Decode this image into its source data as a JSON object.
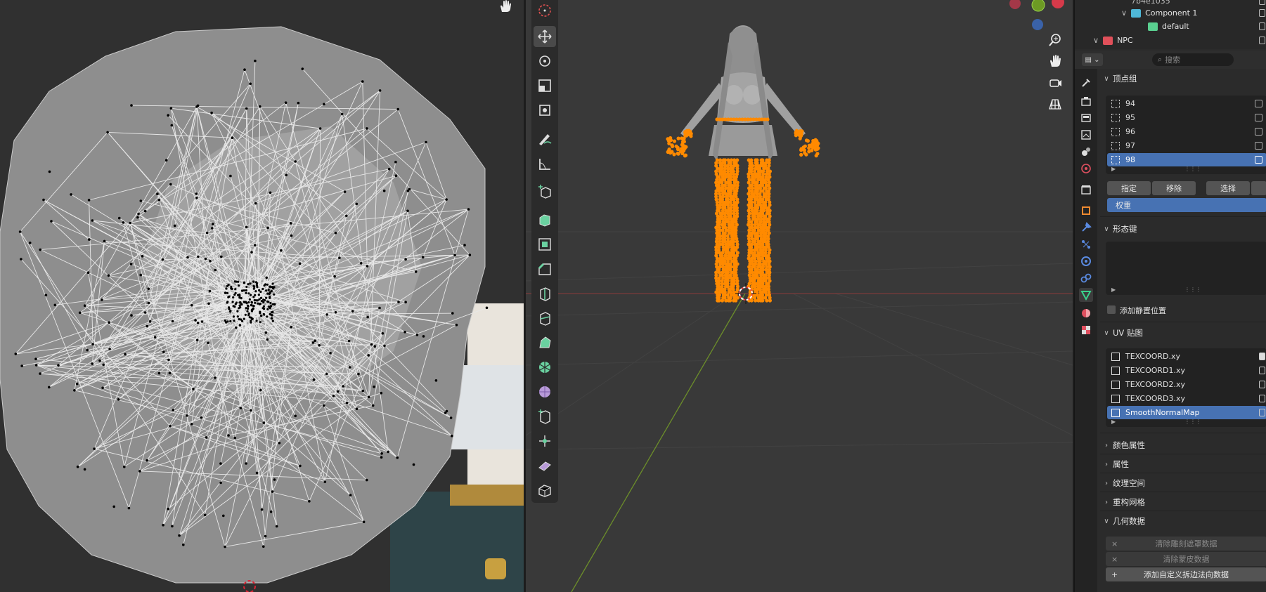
{
  "outliner": {
    "top_item": "7b4e1035",
    "component": "Component 1",
    "default": "default",
    "npc": "NPC"
  },
  "properties": {
    "search_placeholder": "搜索",
    "vertex_groups": {
      "title": "顶点组",
      "items": [
        "94",
        "95",
        "96",
        "97",
        "98"
      ],
      "selected": "98",
      "assign": "指定",
      "remove": "移除",
      "select": "选择",
      "weight": "权重"
    },
    "shape_keys": {
      "title": "形态键",
      "add_rest_position": "添加静置位置"
    },
    "uv_maps": {
      "title": "UV 贴图",
      "items": [
        "TEXCOORD.xy",
        "TEXCOORD1.xy",
        "TEXCOORD2.xy",
        "TEXCOORD3.xy",
        "SmoothNormalMap"
      ],
      "selected": "SmoothNormalMap"
    },
    "color_attributes": "颜色属性",
    "attributes": "属性",
    "texture_space": "纹理空间",
    "remesh": "重构网格",
    "geometry_data": {
      "title": "几何数据",
      "clear_sculpt_mask": "清除雕刻遮罩数据",
      "clear_skin": "清除蒙皮数据",
      "add_custom_normals": "添加自定义拆边法向数据"
    }
  },
  "colors": {
    "selection_orange": "#ff8a00",
    "accent_blue": "#4772b3",
    "panel_bg": "#2b2b2b",
    "viewport_bg": "#393939"
  }
}
